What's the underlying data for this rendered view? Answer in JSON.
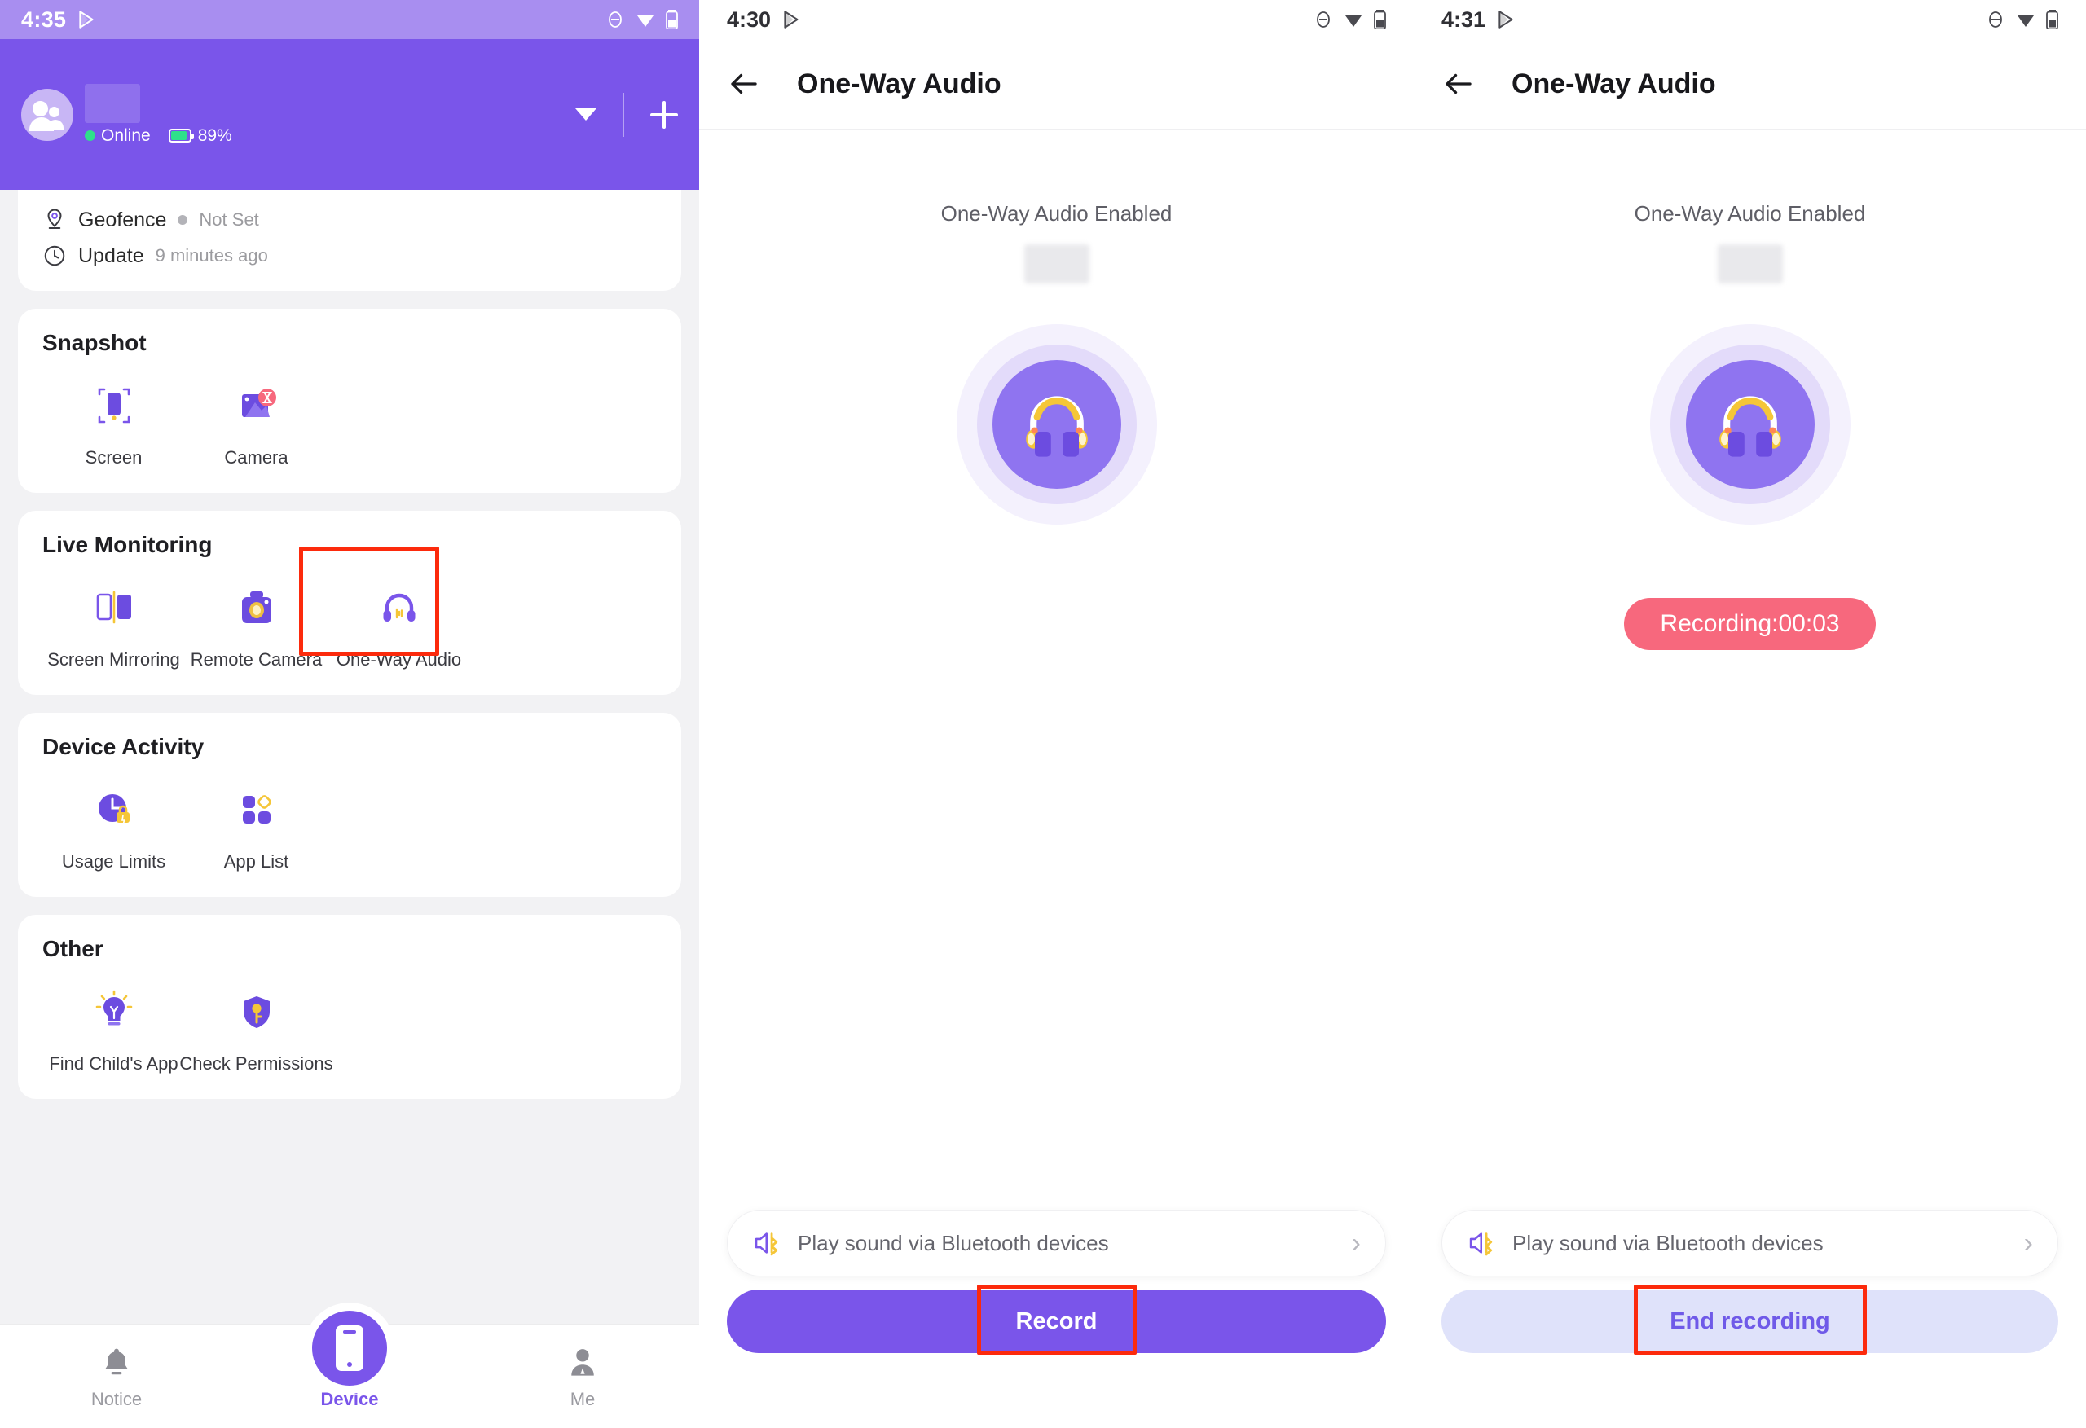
{
  "left_panel": {
    "status_bar": {
      "time": "4:35",
      "icons": [
        "play-store-icon",
        "do-not-disturb-icon",
        "wifi-icon",
        "battery-icon"
      ]
    },
    "header": {
      "avatar": "family-avatar",
      "name_redacted": "",
      "online_label": "Online",
      "battery_label": "89%",
      "dropdown_icon": "chevron-down-icon",
      "add_icon": "plus-icon"
    },
    "info_card": {
      "rows": [
        {
          "icon": "location-pin-icon",
          "label": "Geofence",
          "value": "Not Set",
          "has_dot": true
        },
        {
          "icon": "clock-icon",
          "label": "Update",
          "value": "9 minutes ago",
          "has_dot": false
        }
      ]
    },
    "sections": [
      {
        "title": "Snapshot",
        "tiles": [
          {
            "icon": "screen-capture-icon",
            "label": "Screen",
            "highlighted": false
          },
          {
            "icon": "camera-capture-icon",
            "label": "Camera",
            "highlighted": false
          }
        ]
      },
      {
        "title": "Live Monitoring",
        "tiles": [
          {
            "icon": "screen-mirroring-icon",
            "label": "Screen Mirroring",
            "highlighted": false
          },
          {
            "icon": "remote-camera-icon",
            "label": "Remote Camera",
            "highlighted": false
          },
          {
            "icon": "one-way-audio-icon",
            "label": "One-Way Audio",
            "highlighted": true
          }
        ]
      },
      {
        "title": "Device Activity",
        "tiles": [
          {
            "icon": "usage-limits-icon",
            "label": "Usage Limits",
            "highlighted": false
          },
          {
            "icon": "app-list-icon",
            "label": "App List",
            "highlighted": false
          }
        ]
      },
      {
        "title": "Other",
        "tiles": [
          {
            "icon": "lightbulb-icon",
            "label": "Find Child's App",
            "highlighted": false
          },
          {
            "icon": "shield-key-icon",
            "label": "Check Permissions",
            "highlighted": false
          }
        ]
      }
    ],
    "bottom_nav": [
      {
        "icon": "bell-icon",
        "label": "Notice",
        "active": false
      },
      {
        "icon": "device-phone-icon",
        "label": "Device",
        "active": true
      },
      {
        "icon": "person-icon",
        "label": "Me",
        "active": false
      }
    ]
  },
  "middle_panel": {
    "status_bar": {
      "time": "4:30"
    },
    "header": {
      "back_icon": "back-arrow-icon",
      "title": "One-Way Audio"
    },
    "enabled_text": "One-Way Audio Enabled",
    "illustration": "headphones-illustration",
    "bluetooth_row": {
      "icon": "speaker-bluetooth-icon",
      "text": "Play sound via Bluetooth devices",
      "chevron": "chevron-right-icon"
    },
    "action_button": {
      "label": "Record",
      "highlighted": true
    }
  },
  "right_panel": {
    "status_bar": {
      "time": "4:31"
    },
    "header": {
      "back_icon": "back-arrow-icon",
      "title": "One-Way Audio"
    },
    "enabled_text": "One-Way Audio Enabled",
    "illustration": "headphones-illustration",
    "recording_badge": "Recording:00:03",
    "bluetooth_row": {
      "icon": "speaker-bluetooth-icon",
      "text": "Play sound via Bluetooth devices",
      "chevron": "chevron-right-icon"
    },
    "action_button": {
      "label": "End recording",
      "highlighted": true
    }
  },
  "colors": {
    "brand_purple": "#7a55ea",
    "status_bar_purple": "#a88ef0",
    "online_green": "#2fe08b",
    "recording_red": "#f7687d",
    "highlight_red": "#fc2a0c",
    "end_button_bg": "#dfe2fa",
    "panel_bg": "#f2f2f4",
    "accent_yellow": "#f5c638"
  }
}
